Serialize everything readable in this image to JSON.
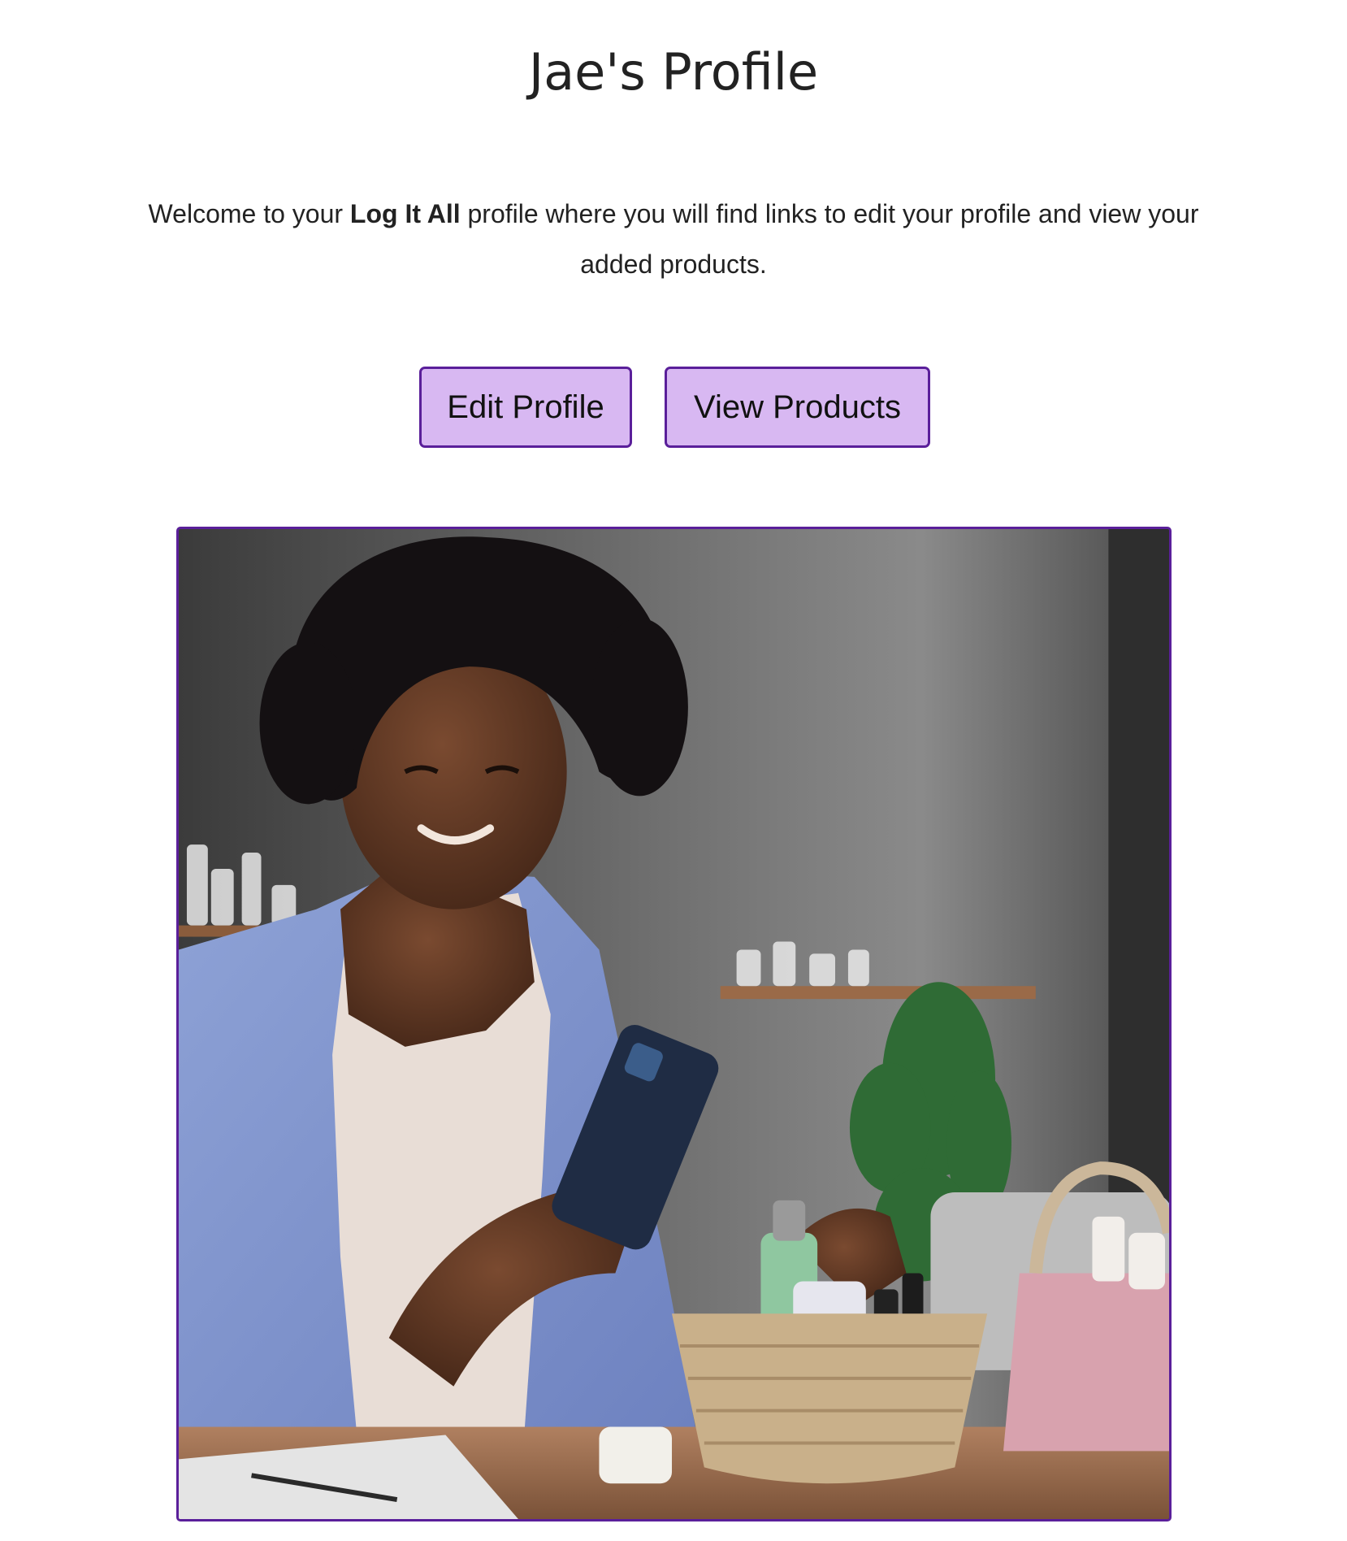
{
  "page": {
    "title": "Jae's Profile",
    "intro": {
      "prefix": "Welcome to your ",
      "brand": "Log It All",
      "suffix": " profile where you will find links to edit your profile and view your added products."
    }
  },
  "actions": {
    "edit_profile_label": "Edit Profile",
    "view_products_label": "View Products"
  },
  "colors": {
    "button_fill": "#d8b8f2",
    "button_border": "#5a1f9a",
    "image_border": "#5a1f9a"
  }
}
